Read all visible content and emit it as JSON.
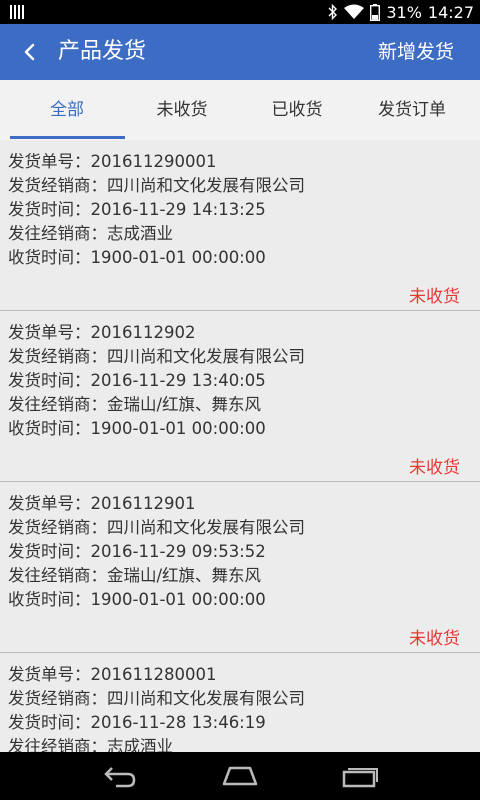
{
  "status_bar": {
    "battery_percent": "31%",
    "time": "14:27"
  },
  "app_bar": {
    "title": "产品发货",
    "action": "新增发货"
  },
  "tabs": [
    {
      "label": "全部",
      "active": true
    },
    {
      "label": "未收货",
      "active": false
    },
    {
      "label": "已收货",
      "active": false
    },
    {
      "label": "发货订单",
      "active": false
    }
  ],
  "shipments": [
    {
      "order_no": "发货单号：201611290001",
      "dealer": "发货经销商：四川尚和文化发展有限公司",
      "ship_time": "发货时间：2016-11-29 14:13:25",
      "to_dealer": "发往经销商：志成酒业",
      "receive_time": "收货时间：1900-01-01 00:00:00",
      "status": "未收货"
    },
    {
      "order_no": "发货单号：2016112902",
      "dealer": "发货经销商：四川尚和文化发展有限公司",
      "ship_time": "发货时间：2016-11-29 13:40:05",
      "to_dealer": "发往经销商：金瑞山/红旗、舞东风",
      "receive_time": "收货时间：1900-01-01 00:00:00",
      "status": "未收货"
    },
    {
      "order_no": "发货单号：2016112901",
      "dealer": "发货经销商：四川尚和文化发展有限公司",
      "ship_time": "发货时间：2016-11-29 09:53:52",
      "to_dealer": "发往经销商：金瑞山/红旗、舞东风",
      "receive_time": "收货时间：1900-01-01 00:00:00",
      "status": "未收货"
    },
    {
      "order_no": "发货单号：201611280001",
      "dealer": "发货经销商：四川尚和文化发展有限公司",
      "ship_time": "发货时间：2016-11-28 13:46:19",
      "to_dealer": "发往经销商：志成酒业",
      "receive_time": "",
      "status": ""
    }
  ],
  "colors": {
    "primary": "#3d6cc5",
    "status_unreceived": "#e53935"
  },
  "icons": {
    "back": "chevron-left-icon",
    "nav": [
      "back-icon",
      "home-icon",
      "recent-apps-icon"
    ]
  }
}
